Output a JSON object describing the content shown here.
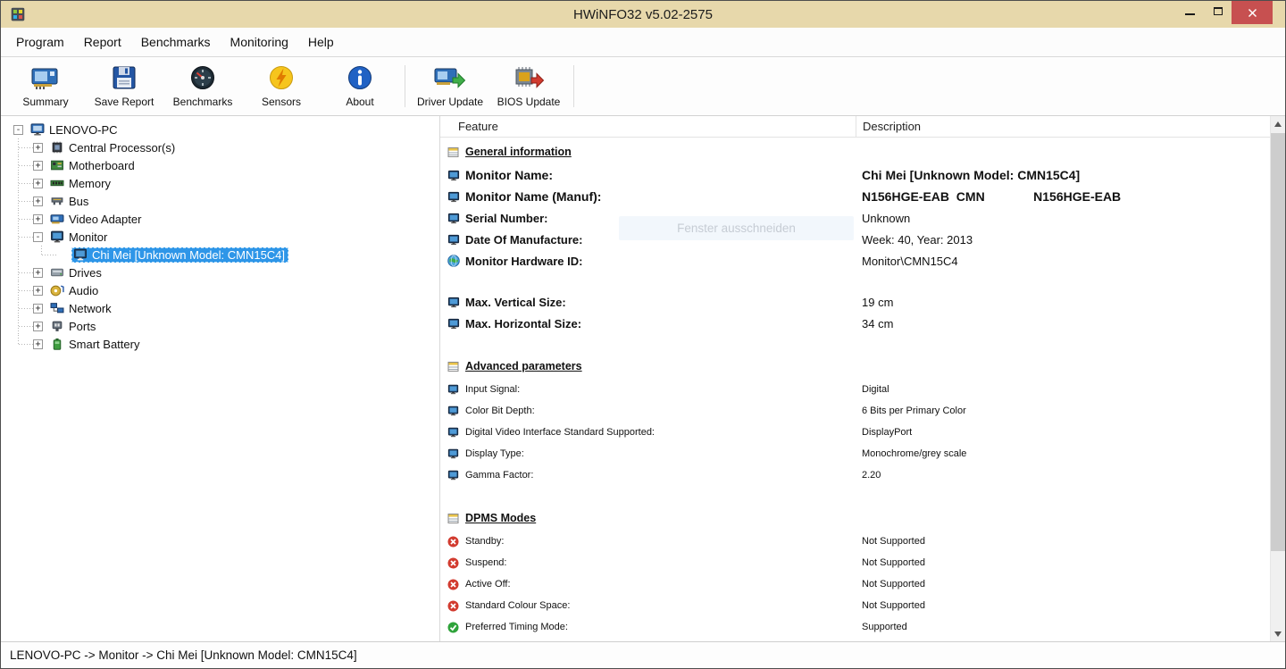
{
  "window": {
    "title": "HWiNFO32 v5.02-2575",
    "app_icon": "hwinfo-logo"
  },
  "menu": {
    "items": [
      "Program",
      "Report",
      "Benchmarks",
      "Monitoring",
      "Help"
    ]
  },
  "toolbar": {
    "buttons": [
      {
        "label": "Summary",
        "icon": "summary-icon"
      },
      {
        "label": "Save Report",
        "icon": "save-report-icon"
      },
      {
        "label": "Benchmarks",
        "icon": "benchmarks-icon"
      },
      {
        "label": "Sensors",
        "icon": "sensors-icon"
      },
      {
        "label": "About",
        "icon": "about-icon"
      },
      {
        "label": "Driver Update",
        "icon": "driver-update-icon"
      },
      {
        "label": "BIOS Update",
        "icon": "bios-update-icon"
      }
    ]
  },
  "tree": {
    "items": [
      {
        "label": "LENOVO-PC",
        "exp": "-",
        "icon": "computer-icon",
        "level": 0
      },
      {
        "label": "Central Processor(s)",
        "exp": "+",
        "icon": "cpu-icon",
        "level": 1
      },
      {
        "label": "Motherboard",
        "exp": "+",
        "icon": "motherboard-icon",
        "level": 1
      },
      {
        "label": "Memory",
        "exp": "+",
        "icon": "memory-icon",
        "level": 1
      },
      {
        "label": "Bus",
        "exp": "+",
        "icon": "bus-icon",
        "level": 1
      },
      {
        "label": "Video Adapter",
        "exp": "+",
        "icon": "video-adapter-icon",
        "level": 1
      },
      {
        "label": "Monitor",
        "exp": "-",
        "icon": "monitor-icon",
        "level": 1
      },
      {
        "label": "Chi Mei [Unknown Model: CMN15C4]",
        "exp": "",
        "icon": "monitor-icon",
        "level": 2,
        "selected": true
      },
      {
        "label": "Drives",
        "exp": "+",
        "icon": "drives-icon",
        "level": 1
      },
      {
        "label": "Audio",
        "exp": "+",
        "icon": "audio-icon",
        "level": 1
      },
      {
        "label": "Network",
        "exp": "+",
        "icon": "network-icon",
        "level": 1
      },
      {
        "label": "Ports",
        "exp": "+",
        "icon": "ports-icon",
        "level": 1
      },
      {
        "label": "Smart Battery",
        "exp": "+",
        "icon": "battery-icon",
        "level": 1
      }
    ]
  },
  "details": {
    "columns": {
      "feature": "Feature",
      "description": "Description"
    },
    "rows": [
      {
        "type": "section",
        "icon": "section-icon",
        "label": "General information"
      },
      {
        "type": "row",
        "size": "xl",
        "icon": "monitor-icon",
        "label": "Monitor Name:",
        "value": "Chi Mei [Unknown Model: CMN15C4]"
      },
      {
        "type": "row",
        "size": "xl",
        "icon": "monitor-icon",
        "label": "Monitor Name (Manuf):",
        "value": "N156HGE-EAB  CMN              N156HGE-EAB"
      },
      {
        "type": "row",
        "size": "lg",
        "icon": "monitor-icon",
        "label": "Serial Number:",
        "value": "Unknown"
      },
      {
        "type": "row",
        "size": "lg",
        "icon": "monitor-icon",
        "label": "Date Of Manufacture:",
        "value": "Week: 40, Year: 2013"
      },
      {
        "type": "row",
        "size": "lg",
        "icon": "globe-icon",
        "label": "Monitor Hardware ID:",
        "value": "Monitor\\CMN15C4"
      },
      {
        "type": "blank"
      },
      {
        "type": "row",
        "size": "lg",
        "icon": "monitor-icon",
        "label": "Max. Vertical Size:",
        "value": "19 cm"
      },
      {
        "type": "row",
        "size": "lg",
        "icon": "monitor-icon",
        "label": "Max. Horizontal Size:",
        "value": "34 cm"
      },
      {
        "type": "blank"
      },
      {
        "type": "section",
        "icon": "section-icon",
        "label": "Advanced parameters"
      },
      {
        "type": "row",
        "size": "sm",
        "icon": "monitor-icon",
        "label": "Input Signal:",
        "value": "Digital"
      },
      {
        "type": "row",
        "size": "sm",
        "icon": "monitor-icon",
        "label": "Color Bit Depth:",
        "value": "6 Bits per Primary Color"
      },
      {
        "type": "row",
        "size": "sm",
        "icon": "monitor-icon",
        "label": "Digital Video Interface Standard Supported:",
        "value": "DisplayPort"
      },
      {
        "type": "row",
        "size": "sm",
        "icon": "monitor-icon",
        "label": "Display Type:",
        "value": "Monochrome/grey scale"
      },
      {
        "type": "row",
        "size": "sm",
        "icon": "monitor-icon",
        "label": "Gamma Factor:",
        "value": "2.20"
      },
      {
        "type": "blank"
      },
      {
        "type": "section",
        "icon": "section-icon",
        "label": "DPMS Modes"
      },
      {
        "type": "row",
        "size": "sm",
        "icon": "not-supported-icon",
        "label": "Standby:",
        "value": "Not Supported"
      },
      {
        "type": "row",
        "size": "sm",
        "icon": "not-supported-icon",
        "label": "Suspend:",
        "value": "Not Supported"
      },
      {
        "type": "row",
        "size": "sm",
        "icon": "not-supported-icon",
        "label": "Active Off:",
        "value": "Not Supported"
      },
      {
        "type": "row",
        "size": "sm",
        "icon": "not-supported-icon",
        "label": "Standard Colour Space:",
        "value": "Not Supported"
      },
      {
        "type": "row",
        "size": "sm",
        "icon": "supported-icon",
        "label": "Preferred Timing Mode:",
        "value": "Supported"
      }
    ]
  },
  "overlay": {
    "text": "Fenster ausschneiden"
  },
  "statusbar": {
    "text": "LENOVO-PC -> Monitor -> Chi Mei [Unknown Model: CMN15C4]"
  },
  "colors": {
    "titlebar": "#e7d8ab",
    "close_button": "#c75050",
    "selection": "#2e96e8",
    "supported": "#2fa33b",
    "not_supported": "#d23b2f"
  }
}
